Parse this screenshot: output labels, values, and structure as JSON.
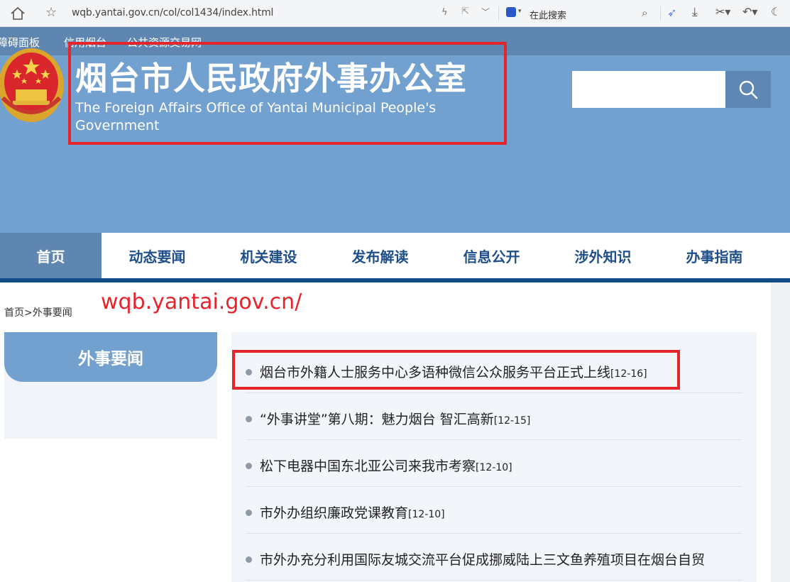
{
  "browser": {
    "url": "wqb.yantai.gov.cn/col/col1434/index.html",
    "search_placeholder": "在此搜索"
  },
  "top_links": [
    "障碍面板",
    "信用烟台",
    "公共资源交易网"
  ],
  "header": {
    "title_cn": "烟台市人民政府外事办公室",
    "title_en": "The Foreign Affairs Office of Yantai Municipal People's Government"
  },
  "nav": [
    "首页",
    "动态要闻",
    "机关建设",
    "发布解读",
    "信息公开",
    "涉外知识",
    "办事指南"
  ],
  "breadcrumb": {
    "home": "首页",
    "sep": ">",
    "current": "外事要闻"
  },
  "site_url": "wqb.yantai.gov.cn/",
  "side_tab": "外事要闻",
  "news": [
    {
      "title": "烟台市外籍人士服务中心多语种微信公众服务平台正式上线",
      "date": "[12-16]"
    },
    {
      "title": "“外事讲堂”第八期：魅力烟台 智汇高新",
      "date": "[12-15]"
    },
    {
      "title": "松下电器中国东北亚公司来我市考察",
      "date": "[12-10]"
    },
    {
      "title": "市外办组织廉政党课教育",
      "date": "[12-10]"
    },
    {
      "title": "市外办充分利用国际友城交流平台促成挪威陆上三文鱼养殖项目在烟台自贸",
      "date": ""
    }
  ],
  "colors": {
    "header_bg": "#72a0cf",
    "top_strip": "#5f86b0",
    "nav_text": "#1f4f8a",
    "nav_rule": "#114c86",
    "highlight": "#e5242b"
  }
}
